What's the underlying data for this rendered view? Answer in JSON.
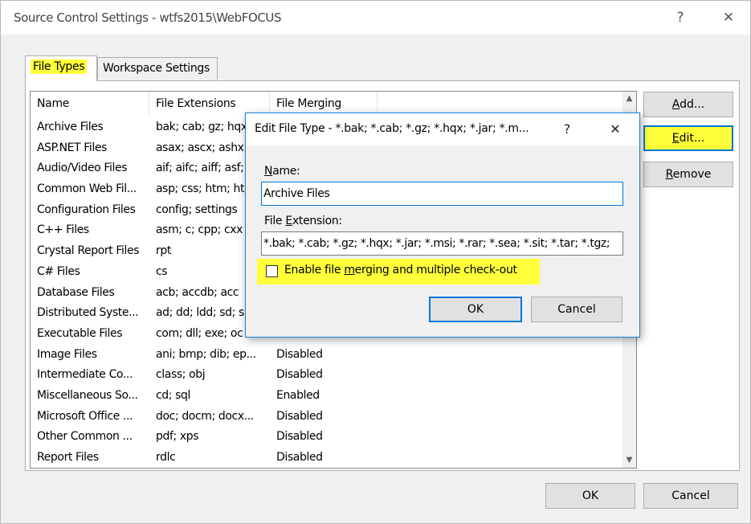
{
  "window": {
    "title": "Source Control Settings - wtfs2015\\WebFOCUS",
    "help_glyph": "?",
    "close_glyph": "✕"
  },
  "tabs": [
    {
      "label": "File Types",
      "active": true
    },
    {
      "label": "Workspace Settings",
      "active": false
    }
  ],
  "list": {
    "columns": [
      "Name",
      "File Extensions",
      "File Merging"
    ],
    "rows": [
      {
        "name": "Archive Files",
        "ext": "bak; cab; gz; hqx",
        "merge": ""
      },
      {
        "name": "ASP.NET Files",
        "ext": "asax; ascx; ashx;",
        "merge": ""
      },
      {
        "name": "Audio/Video Files",
        "ext": "aif; aifc; aiff; asf;",
        "merge": ""
      },
      {
        "name": "Common Web Fil...",
        "ext": "asp; css; htm; ht",
        "merge": ""
      },
      {
        "name": "Configuration Files",
        "ext": "config; settings",
        "merge": ""
      },
      {
        "name": "C++ Files",
        "ext": "asm; c; cpp; cxx",
        "merge": ""
      },
      {
        "name": "Crystal Report Files",
        "ext": "rpt",
        "merge": ""
      },
      {
        "name": "C# Files",
        "ext": "cs",
        "merge": ""
      },
      {
        "name": "Database Files",
        "ext": "acb; accdb; acc",
        "merge": ""
      },
      {
        "name": "Distributed Syste...",
        "ext": "ad; dd; ldd; sd; s",
        "merge": ""
      },
      {
        "name": "Executable Files",
        "ext": "com; dll; exe; oc",
        "merge": ""
      },
      {
        "name": "Image Files",
        "ext": "ani; bmp; dib; ep...",
        "merge": "Disabled"
      },
      {
        "name": "Intermediate Co...",
        "ext": "class; obj",
        "merge": "Disabled"
      },
      {
        "name": "Miscellaneous So...",
        "ext": "cd; sql",
        "merge": "Enabled"
      },
      {
        "name": "Microsoft Office ...",
        "ext": "doc; docm; docx...",
        "merge": "Disabled"
      },
      {
        "name": "Other Common ...",
        "ext": "pdf; xps",
        "merge": "Disabled"
      },
      {
        "name": "Report Files",
        "ext": "rdlc",
        "merge": "Disabled"
      }
    ],
    "scroll_up_glyph": "▲",
    "scroll_down_glyph": "▼"
  },
  "side_buttons": {
    "add_label_u": "A",
    "add_label_rest": "dd...",
    "edit_label_u": "E",
    "edit_label_rest": "dit...",
    "remove_label_u": "R",
    "remove_label_rest": "emove"
  },
  "footer": {
    "ok_label": "OK",
    "cancel_label": "Cancel"
  },
  "edit_dialog": {
    "title": "Edit File Type - *.bak; *.cab; *.gz; *.hqx; *.jar; *.m...",
    "help_glyph": "?",
    "close_glyph": "✕",
    "name_label_u": "N",
    "name_label_rest": "ame:",
    "name_value": "Archive Files",
    "ext_label_pre": "File ",
    "ext_label_u": "E",
    "ext_label_rest": "xtension:",
    "ext_value": "*.bak; *.cab; *.gz; *.hqx; *.jar; *.msi; *.rar; *.sea; *.sit; *.tar; *.tgz;",
    "merge_label_pre": "Enable file ",
    "merge_label_u": "m",
    "merge_label_rest": "erging and multiple check-out",
    "merge_checked": false,
    "ok_label": "OK",
    "cancel_label": "Cancel"
  },
  "colors": {
    "highlight": "#ffff3a",
    "focus_blue": "#0078d7"
  }
}
